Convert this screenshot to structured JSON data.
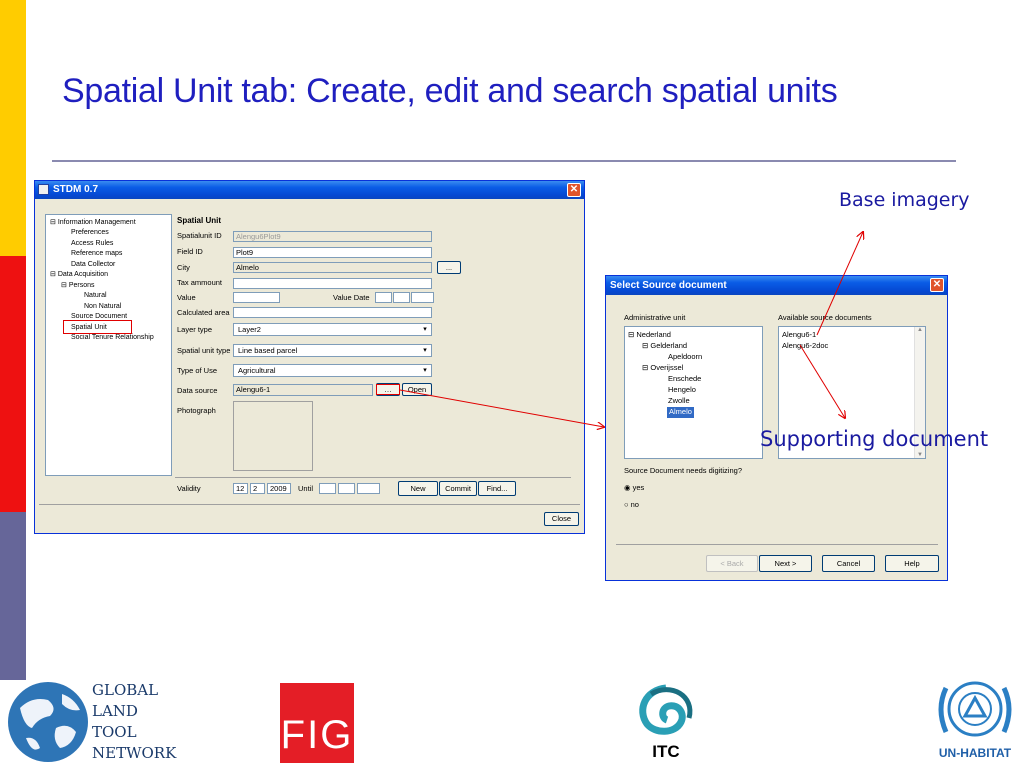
{
  "slide": {
    "title": "Spatial Unit tab: Create, edit and search spatial units"
  },
  "main_window": {
    "title": "STDM 0.7",
    "tree": [
      "Information Management",
      "Preferences",
      "Access Rules",
      "Reference maps",
      "Data Collector",
      "Data Acquisition",
      "Persons",
      "Natural",
      "Non Natural",
      "Source Document",
      "Spatial Unit",
      "Social Tenure Relationship"
    ],
    "form": {
      "heading": "Spatial Unit",
      "spatialunit_id_label": "Spatialunit ID",
      "spatialunit_id_value": "Alengu6Plot9",
      "field_id_label": "Field ID",
      "field_id_value": "Plot9",
      "city_label": "City",
      "city_value": "Almelo",
      "browse_label": "...",
      "tax_label": "Tax ammount",
      "value_label": "Value",
      "value_date_label": "Value Date",
      "calc_area_label": "Calculated area",
      "layer_type_label": "Layer type",
      "layer_type_value": "Layer2",
      "su_type_label": "Spatial unit type",
      "su_type_value": "Line based parcel",
      "type_use_label": "Type of Use",
      "type_use_value": "Agricultural",
      "data_source_label": "Data source",
      "data_source_value": "Alengu6-1",
      "open_label": "Open",
      "photo_label": "Photograph",
      "validity_label": "Validity",
      "validity_day": "12",
      "validity_month": "2",
      "validity_year": "2009",
      "until_label": "Until",
      "new_label": "New",
      "commit_label": "Commit",
      "find_label": "Find...",
      "close_label": "Close"
    }
  },
  "dialog": {
    "title": "Select Source document",
    "admin_unit_label": "Administrative unit",
    "available_label": "Available source documents",
    "admin_tree": [
      "Nederland",
      "Gelderland",
      "Apeldoorn",
      "Overijssel",
      "Enschede",
      "Hengelo",
      "Zwolle",
      "Almelo"
    ],
    "docs": [
      "Alengu6-1",
      "Alengu6-2doc"
    ],
    "digitize_question": "Source Document needs digitizing?",
    "opt_yes": "yes",
    "opt_no": "no",
    "back_label": "< Back",
    "next_label": "Next >",
    "cancel_label": "Cancel",
    "help_label": "Help"
  },
  "annotations": {
    "base_imagery": "Base imagery",
    "supporting_document": "Supporting document"
  },
  "logos": {
    "gltn_lines": [
      "GLOBAL",
      "LAND",
      "TOOL",
      "NETWORK"
    ],
    "fig": "FIG",
    "itc": "ITC",
    "unhabitat": "UN-HABITAT"
  },
  "colors": {
    "title_blue": "#1f1fbf",
    "bar_yellow": "#ffcc00",
    "bar_red": "#ee1111",
    "bar_purple": "#666699",
    "annotation_red": "#e00000"
  }
}
